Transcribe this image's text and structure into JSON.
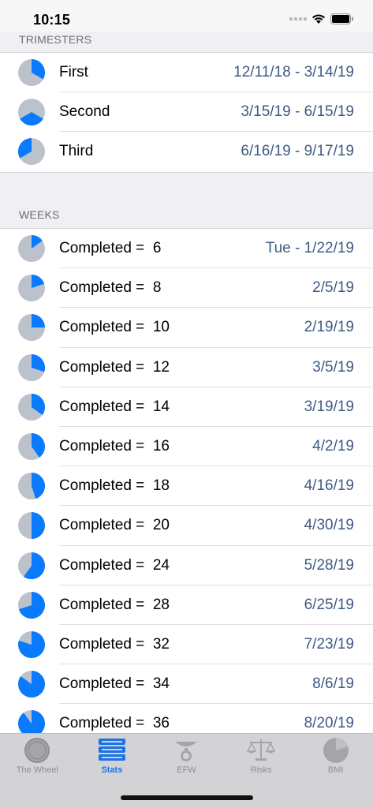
{
  "status_bar": {
    "time": "10:15"
  },
  "colors": {
    "pie_fill": "#0a7aff",
    "pie_bg": "#bcc2cc",
    "value_text": "#3e5a83"
  },
  "trimesters": {
    "header": "TRIMESTERS",
    "rows": [
      {
        "label": "First",
        "value": "12/11/18 - 3/14/19",
        "pie_start": 0.0,
        "pie_end": 0.333
      },
      {
        "label": "Second",
        "value": "3/15/19 - 6/15/19",
        "pie_start": 0.333,
        "pie_end": 0.667
      },
      {
        "label": "Third",
        "value": "6/16/19 - 9/17/19",
        "pie_start": 0.667,
        "pie_end": 1.0
      }
    ]
  },
  "weeks": {
    "header": "WEEKS",
    "rows": [
      {
        "label": "Completed =  6",
        "value": "Tue - 1/22/19",
        "fraction": 0.15
      },
      {
        "label": "Completed =  8",
        "value": "2/5/19",
        "fraction": 0.2
      },
      {
        "label": "Completed =  10",
        "value": "2/19/19",
        "fraction": 0.25
      },
      {
        "label": "Completed =  12",
        "value": "3/5/19",
        "fraction": 0.3
      },
      {
        "label": "Completed =  14",
        "value": "3/19/19",
        "fraction": 0.35
      },
      {
        "label": "Completed =  16",
        "value": "4/2/19",
        "fraction": 0.4
      },
      {
        "label": "Completed =  18",
        "value": "4/16/19",
        "fraction": 0.45
      },
      {
        "label": "Completed =  20",
        "value": "4/30/19",
        "fraction": 0.5
      },
      {
        "label": "Completed =  24",
        "value": "5/28/19",
        "fraction": 0.6
      },
      {
        "label": "Completed =  28",
        "value": "6/25/19",
        "fraction": 0.7
      },
      {
        "label": "Completed =  32",
        "value": "7/23/19",
        "fraction": 0.8
      },
      {
        "label": "Completed =  34",
        "value": "8/6/19",
        "fraction": 0.85
      },
      {
        "label": "Completed =  36",
        "value": "8/20/19",
        "fraction": 0.9
      }
    ]
  },
  "tab_bar": {
    "tabs": [
      {
        "label": "The Wheel",
        "icon": "wheel-icon",
        "active": false
      },
      {
        "label": "Stats",
        "icon": "stats-icon",
        "active": true
      },
      {
        "label": "EFW",
        "icon": "scale-icon",
        "active": false
      },
      {
        "label": "Risks",
        "icon": "balance-icon",
        "active": false
      },
      {
        "label": "BMI",
        "icon": "bmi-pie-icon",
        "active": false
      }
    ]
  }
}
